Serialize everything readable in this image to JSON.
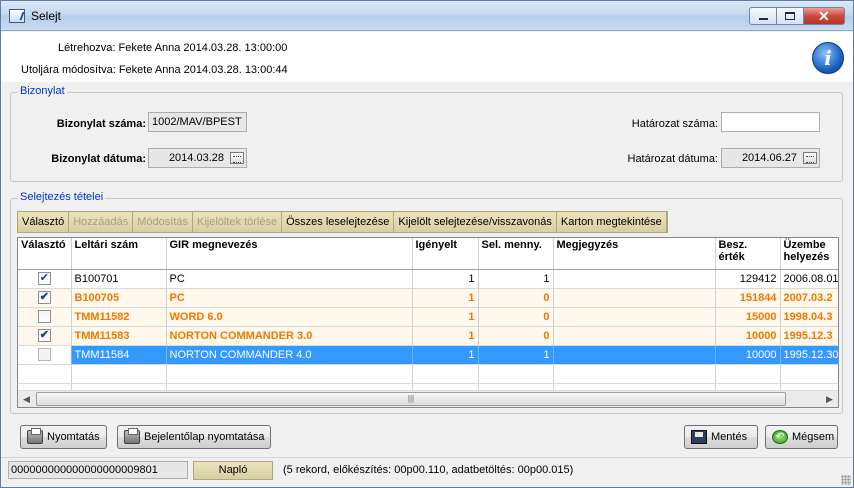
{
  "window": {
    "title": "Selejt"
  },
  "info": {
    "created_label": "Létrehozva:",
    "created_value": "Fekete Anna 2014.03.28.  13:00:00",
    "modified_label": "Utoljára módosítva:",
    "modified_value": "Fekete Anna 2014.03.28.  13:00:44"
  },
  "bizonylat": {
    "group_title": "Bizonylat",
    "number_label": "Bizonylat száma:",
    "number_value": "1002/MAV/BPEST",
    "date_label": "Bizonylat dátuma:",
    "date_value": "2014.03.28",
    "decision_number_label": "Határozat száma:",
    "decision_number_value": "",
    "decision_date_label": "Határozat dátuma:",
    "decision_date_value": "2014.06.27"
  },
  "items": {
    "group_title": "Selejtezés tételei",
    "toolbar": [
      {
        "label": "Választó",
        "enabled": true
      },
      {
        "label": "Hozzáadás",
        "enabled": false
      },
      {
        "label": "Módosítás",
        "enabled": false
      },
      {
        "label": "Kijelöltek törlése",
        "enabled": false
      },
      {
        "label": "Összes leselejtezése",
        "enabled": true
      },
      {
        "label": "Kijelölt selejtezése/visszavonás",
        "enabled": true
      },
      {
        "label": "Karton megtekintése",
        "enabled": true
      }
    ],
    "columns": [
      "Választó",
      "Leltári szám",
      "GIR megnevezés",
      "Igényelt",
      "Sel. menny.",
      "Megjegyzés",
      "Besz. érték",
      "Üzembe helyezés"
    ],
    "rows": [
      {
        "checked": true,
        "style": "normal",
        "leltari": "B100701",
        "nev": "PC",
        "igenyelt": "1",
        "sel": "1",
        "megj": "",
        "ertek": "129412",
        "datum": "2006.08.01"
      },
      {
        "checked": true,
        "style": "orange",
        "leltari": "B100705",
        "nev": "PC",
        "igenyelt": "1",
        "sel": "0",
        "megj": "",
        "ertek": "151844",
        "datum": "2007.03.2"
      },
      {
        "checked": false,
        "style": "orange",
        "leltari": "TMM11582",
        "nev": "WORD 6.0",
        "igenyelt": "1",
        "sel": "0",
        "megj": "",
        "ertek": "15000",
        "datum": "1998.04.3"
      },
      {
        "checked": true,
        "style": "orange",
        "leltari": "TMM11583",
        "nev": "NORTON COMMANDER 3.0",
        "igenyelt": "1",
        "sel": "0",
        "megj": "",
        "ertek": "10000",
        "datum": "1995.12.3"
      },
      {
        "checked": false,
        "style": "sel",
        "leltari": "TMM11584",
        "nev": "NORTON COMMANDER 4.0",
        "igenyelt": "1",
        "sel": "1",
        "megj": "",
        "ertek": "10000",
        "datum": "1995.12.30"
      }
    ]
  },
  "buttons": {
    "print": "Nyomtatás",
    "print_report": "Bejelentőlap nyomtatása",
    "save": "Mentés",
    "cancel": "Mégsem"
  },
  "status": {
    "id_value": "000000000000000000009801",
    "log_button": "Napló",
    "message": "(5 rekord, előkészítés: 00p00.110, adatbetöltés: 00p00.015)"
  }
}
